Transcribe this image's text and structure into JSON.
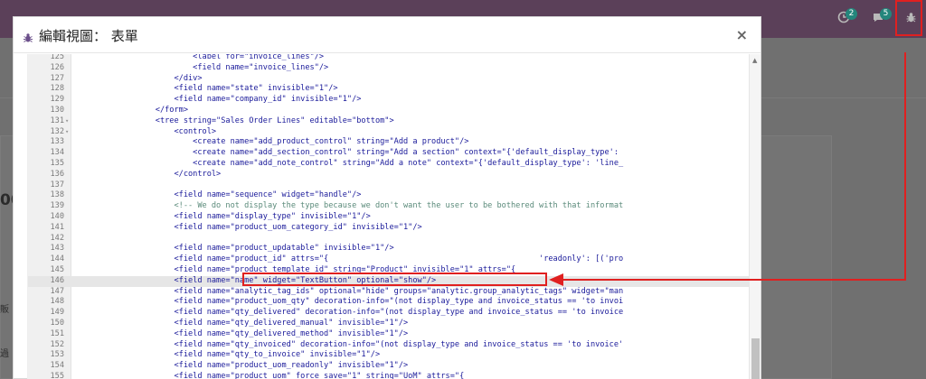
{
  "topbar": {
    "activity_badge": "2",
    "messages_badge": "5"
  },
  "background": {
    "left_chars": [
      "00",
      "販",
      "過"
    ]
  },
  "modal": {
    "title": "編輯視圖： 表單",
    "close_label": "×"
  },
  "editor": {
    "lines": [
      {
        "n": "125",
        "fold": "",
        "code": "                        <label for=\"invoice_lines\"/>"
      },
      {
        "n": "126",
        "fold": "",
        "code": "                        <field name=\"invoice_lines\"/>"
      },
      {
        "n": "127",
        "fold": "",
        "code": "                    </div>"
      },
      {
        "n": "128",
        "fold": "",
        "code": "                    <field name=\"state\" invisible=\"1\"/>"
      },
      {
        "n": "129",
        "fold": "",
        "code": "                    <field name=\"company_id\" invisible=\"1\"/>"
      },
      {
        "n": "130",
        "fold": "",
        "code": "                </form>"
      },
      {
        "n": "131",
        "fold": "▾",
        "code": "                <tree string=\"Sales Order Lines\" editable=\"bottom\">"
      },
      {
        "n": "132",
        "fold": "▾",
        "code": "                    <control>"
      },
      {
        "n": "133",
        "fold": "",
        "code": "                        <create name=\"add_product_control\" string=\"Add a product\"/>"
      },
      {
        "n": "134",
        "fold": "",
        "code": "                        <create name=\"add_section_control\" string=\"Add a section\" context=\"{'default_display_type':"
      },
      {
        "n": "135",
        "fold": "",
        "code": "                        <create name=\"add_note_control\" string=\"Add a note\" context=\"{'default_display_type': 'line_"
      },
      {
        "n": "136",
        "fold": "",
        "code": "                    </control>"
      },
      {
        "n": "137",
        "fold": "",
        "code": ""
      },
      {
        "n": "138",
        "fold": "",
        "code": "                    <field name=\"sequence\" widget=\"handle\"/>"
      },
      {
        "n": "139",
        "fold": "",
        "code": "                    <!-- We do not display the type because we don't want the user to be bothered with that informat"
      },
      {
        "n": "140",
        "fold": "",
        "code": "                    <field name=\"display_type\" invisible=\"1\"/>"
      },
      {
        "n": "141",
        "fold": "",
        "code": "                    <field name=\"product_uom_category_id\" invisible=\"1\"/>"
      },
      {
        "n": "142",
        "fold": "",
        "code": ""
      },
      {
        "n": "143",
        "fold": "",
        "code": "                    <field name=\"product_updatable\" invisible=\"1\"/>"
      },
      {
        "n": "144",
        "fold": "",
        "code": "                    <field name=\"product_id\" attrs=\"{                                             'readonly': [('pro"
      },
      {
        "n": "145",
        "fold": "",
        "code": "                    <field name=\"product_template_id\" string=\"Product\" invisible=\"1\" attrs=\"{"
      },
      {
        "n": "146",
        "fold": "",
        "code": "                    <field name=\"name\" widget=\"TextButton\" optional=\"show\"/>"
      },
      {
        "n": "147",
        "fold": "",
        "code": "                    <field name=\"analytic_tag_ids\" optional=\"hide\" groups=\"analytic.group_analytic_tags\" widget=\"man"
      },
      {
        "n": "148",
        "fold": "",
        "code": "                    <field name=\"product_uom_qty\" decoration-info=\"(not display_type and invoice_status == 'to invoi"
      },
      {
        "n": "149",
        "fold": "",
        "code": "                    <field name=\"qty_delivered\" decoration-info=\"(not display_type and invoice_status == 'to invoice"
      },
      {
        "n": "150",
        "fold": "",
        "code": "                    <field name=\"qty_delivered_manual\" invisible=\"1\"/>"
      },
      {
        "n": "151",
        "fold": "",
        "code": "                    <field name=\"qty_delivered_method\" invisible=\"1\"/>"
      },
      {
        "n": "152",
        "fold": "",
        "code": "                    <field name=\"qty_invoiced\" decoration-info=\"(not display_type and invoice_status == 'to invoice'"
      },
      {
        "n": "153",
        "fold": "",
        "code": "                    <field name=\"qty_to_invoice\" invisible=\"1\"/>"
      },
      {
        "n": "154",
        "fold": "",
        "code": "                    <field name=\"product_uom_readonly\" invisible=\"1\"/>"
      },
      {
        "n": "155",
        "fold": "",
        "code": "                    <field name=\"product_uom\" force_save=\"1\" string=\"UoM\" attrs=\"{"
      }
    ],
    "active_line": "146"
  },
  "colors": {
    "highlight": "#e02020",
    "topbar": "#5b4059"
  },
  "icons": [
    "bug-icon",
    "clock-icon",
    "chat-icon",
    "bug-icon-topbar",
    "close-icon"
  ]
}
